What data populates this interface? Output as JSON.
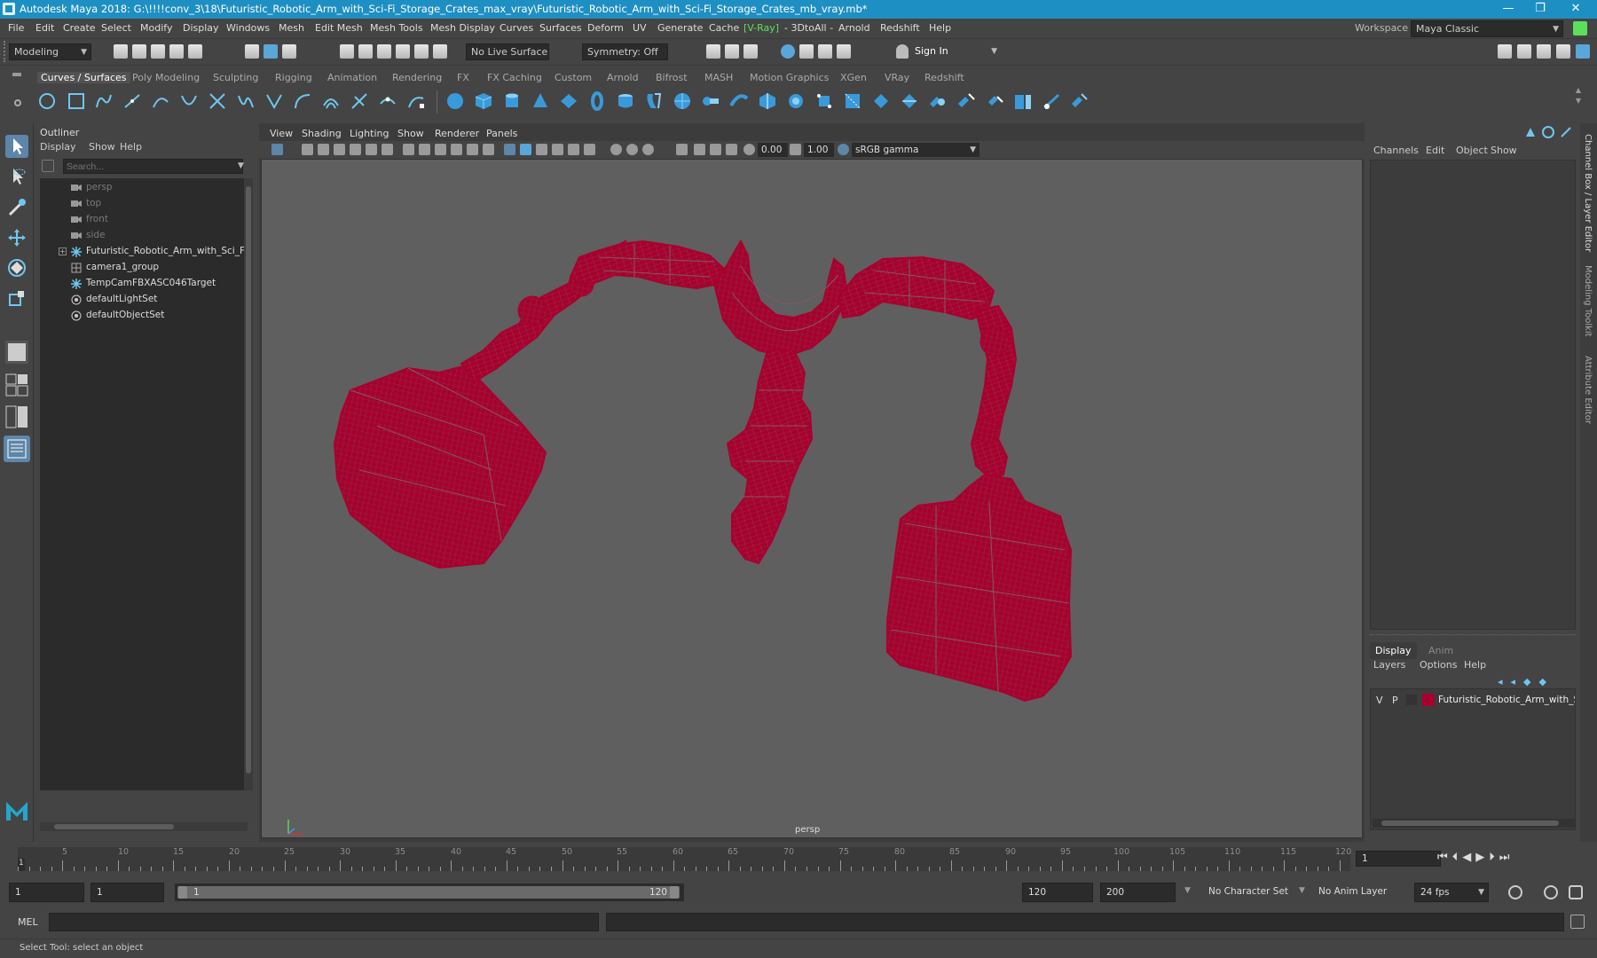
{
  "window": {
    "title": "Autodesk Maya 2018: G:\\!!!!conv_3\\18\\Futuristic_Robotic_Arm_with_Sci-Fi_Storage_Crates_max_vray\\Futuristic_Robotic_Arm_with_Sci-Fi_Storage_Crates_mb_vray.mb*",
    "minimize": "—",
    "maximize": "❐",
    "close": "✕"
  },
  "menu": [
    "File",
    "Edit",
    "Create",
    "Select",
    "Modify",
    "Display",
    "Windows",
    "Mesh",
    "Edit Mesh",
    "Mesh Tools",
    "Mesh Display",
    "Curves",
    "Surfaces",
    "Deform",
    "UV",
    "Generate",
    "Cache",
    "[V-Ray]",
    "- 3DtoAll -",
    "Arnold",
    "Redshift",
    "Help"
  ],
  "workspace": {
    "label": "Workspace :",
    "value": "Maya Classic"
  },
  "statusline": {
    "mode": "Modeling",
    "live_surface": "No Live Surface",
    "symmetry": "Symmetry: Off",
    "sign_in": "Sign In"
  },
  "shelf": {
    "tabs": [
      "Curves / Surfaces",
      "Poly Modeling",
      "Sculpting",
      "Rigging",
      "Animation",
      "Rendering",
      "FX",
      "FX Caching",
      "Custom",
      "Arnold",
      "Bifrost",
      "MASH",
      "Motion Graphics",
      "XGen",
      "VRay",
      "Redshift"
    ],
    "active": "Curves / Surfaces"
  },
  "outliner": {
    "title": "Outliner",
    "menus": [
      "Display",
      "Show",
      "Help"
    ],
    "search_placeholder": "Search...",
    "items": [
      {
        "label": "persp",
        "icon": "camera-icon",
        "dim": true
      },
      {
        "label": "top",
        "icon": "camera-icon",
        "dim": true
      },
      {
        "label": "front",
        "icon": "camera-icon",
        "dim": true
      },
      {
        "label": "side",
        "icon": "camera-icon",
        "dim": true
      },
      {
        "label": "Futuristic_Robotic_Arm_with_Sci_Fi_S",
        "icon": "transform-icon",
        "dim": false,
        "expandable": true
      },
      {
        "label": "camera1_group",
        "icon": "group-icon",
        "dim": false
      },
      {
        "label": "TempCamFBXASC046Target",
        "icon": "transform-icon",
        "dim": false
      },
      {
        "label": "defaultLightSet",
        "icon": "set-icon",
        "dim": false
      },
      {
        "label": "defaultObjectSet",
        "icon": "set-icon",
        "dim": false
      }
    ]
  },
  "viewport": {
    "menus": [
      "View",
      "Shading",
      "Lighting",
      "Show",
      "Renderer",
      "Panels"
    ],
    "exposure": "0.00",
    "gamma": "1.00",
    "colorspace": "sRGB gamma",
    "camera_label": "persp",
    "wire_color": "#a8002e"
  },
  "channelbox": {
    "menus": [
      "Channels",
      "Edit",
      "Object",
      "Show"
    ]
  },
  "layers": {
    "tabs": [
      "Display",
      "Anim"
    ],
    "menus": [
      "Layers",
      "Options",
      "Help"
    ],
    "rows": [
      {
        "v": "V",
        "p": "P",
        "name": "Futuristic_Robotic_Arm_with_Sc",
        "color": "#a8002e"
      }
    ]
  },
  "sidetabs": [
    "Channel Box / Layer Editor",
    "Modeling Toolkit",
    "Attribute Editor"
  ],
  "timeline": {
    "ticks": [
      "5",
      "10",
      "15",
      "20",
      "25",
      "30",
      "35",
      "40",
      "45",
      "50",
      "55",
      "60",
      "65",
      "70",
      "75",
      "80",
      "85",
      "90",
      "95",
      "100",
      "105",
      "110",
      "115",
      "120"
    ],
    "current_frame_marker": "1",
    "current_frame": "1"
  },
  "range": {
    "start": "1",
    "anim_start": "1",
    "range_start": "1",
    "range_end": "120",
    "anim_end": "120",
    "end": "200",
    "character_set": "No Character Set",
    "anim_layer": "No Anim Layer",
    "fps": "24 fps"
  },
  "command": {
    "label": "MEL"
  },
  "help": {
    "text": "Select Tool: select an object"
  }
}
